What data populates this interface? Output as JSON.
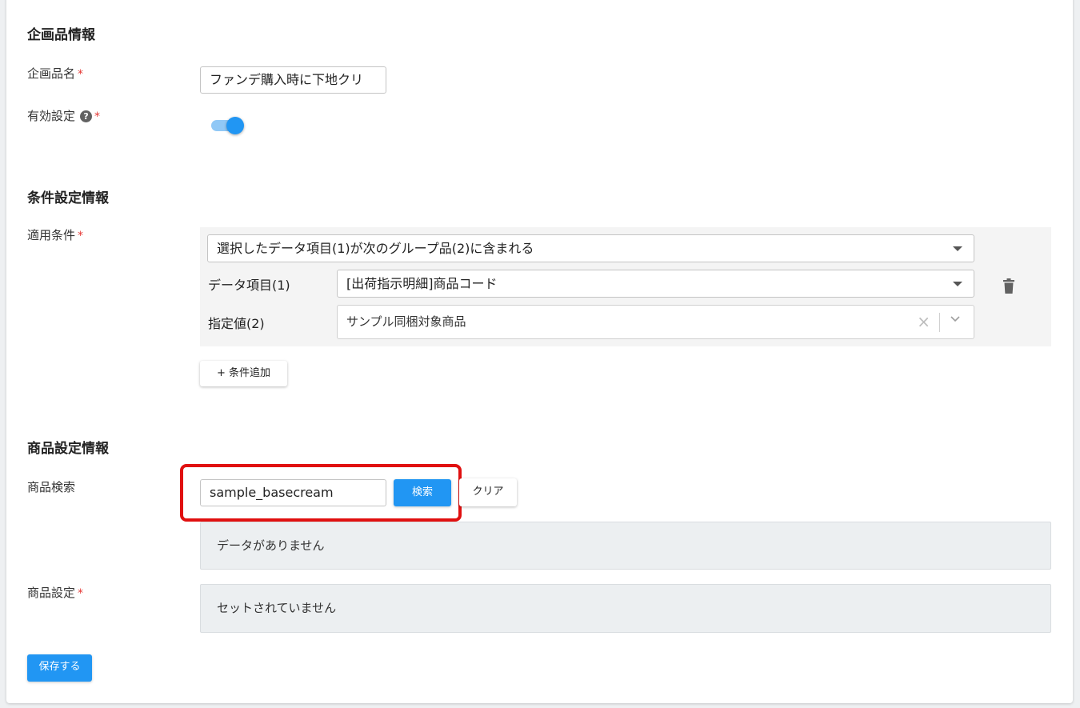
{
  "sections": {
    "plan": {
      "title": "企画品情報",
      "name_label": "企画品名",
      "name_value": "ファンデ購入時に下地クリ",
      "enabled_label": "有効設定",
      "help_glyph": "?",
      "required_mark": "*",
      "enabled_on": true
    },
    "conditions": {
      "title": "条件設定情報",
      "apply_label": "適用条件",
      "rule_select": "選択したデータ項目(1)が次のグループ品(2)に含まれる",
      "data_item_label": "データ項目(1)",
      "data_item_value": "[出荷指示明細]商品コード",
      "specified_label": "指定値(2)",
      "specified_value": "サンプル同梱対象商品",
      "clear_glyph": "×",
      "add_button": "+ 条件追加"
    },
    "products": {
      "title": "商品設定情報",
      "search_label": "商品検索",
      "search_value": "sample_basecream",
      "search_button": "検索",
      "clear_button": "クリア",
      "no_data": "データがありません",
      "setting_label": "商品設定",
      "not_set": "セットされていません"
    }
  },
  "footer": {
    "save_button": "保存する"
  },
  "colors": {
    "primary": "#2196f3",
    "required": "#e53935",
    "highlight": "#e01010"
  },
  "icons": {
    "help": "help-circle-icon",
    "trash": "trash-icon",
    "chevron": "chevron-down-icon",
    "caret": "caret-down-icon",
    "clear": "close-icon"
  }
}
